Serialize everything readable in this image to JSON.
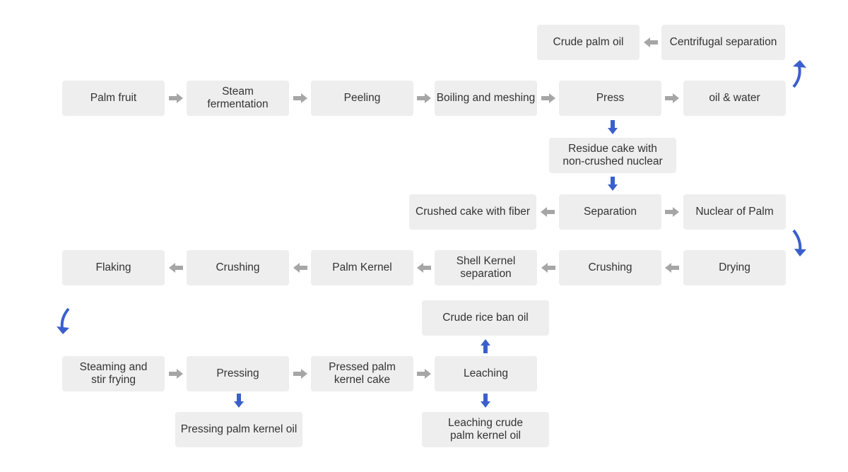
{
  "colors": {
    "box": "#eeeeee",
    "text": "#333333",
    "flow_arrow": "#a6a6a6",
    "branch_arrow": "#3a5fcd"
  },
  "nodes": {
    "crude_palm_oil": "Crude palm oil",
    "centrifugal_separation": "Centrifugal separation",
    "palm_fruit": "Palm fruit",
    "steam_fermentation": "Steam\nfermentation",
    "peeling": "Peeling",
    "boiling_meshing": "Boiling and meshing",
    "press": "Press",
    "oil_water": "oil & water",
    "residue_cake": "Residue cake with\nnon-crushed nuclear",
    "crushed_cake_fiber": "Crushed cake with fiber",
    "separation": "Separation",
    "nuclear_palm": "Nuclear of Palm",
    "flaking": "Flaking",
    "crushing_2": "Crushing",
    "palm_kernel": "Palm Kernel",
    "shell_kernel_separation": "Shell Kernel\nseparation",
    "crushing_1": "Crushing",
    "drying": "Drying",
    "crude_rice_ban_oil": "Crude rice ban oil",
    "steaming_stir_frying": "Steaming and\nstir frying",
    "pressing": "Pressing",
    "pressed_palm_kernel_cake": "Pressed palm\nkernel cake",
    "leaching": "Leaching",
    "pressing_palm_kernel_oil": "Pressing palm kernel oil",
    "leaching_crude_palm_kernel_oil": "Leaching crude\npalm kernel oil"
  }
}
